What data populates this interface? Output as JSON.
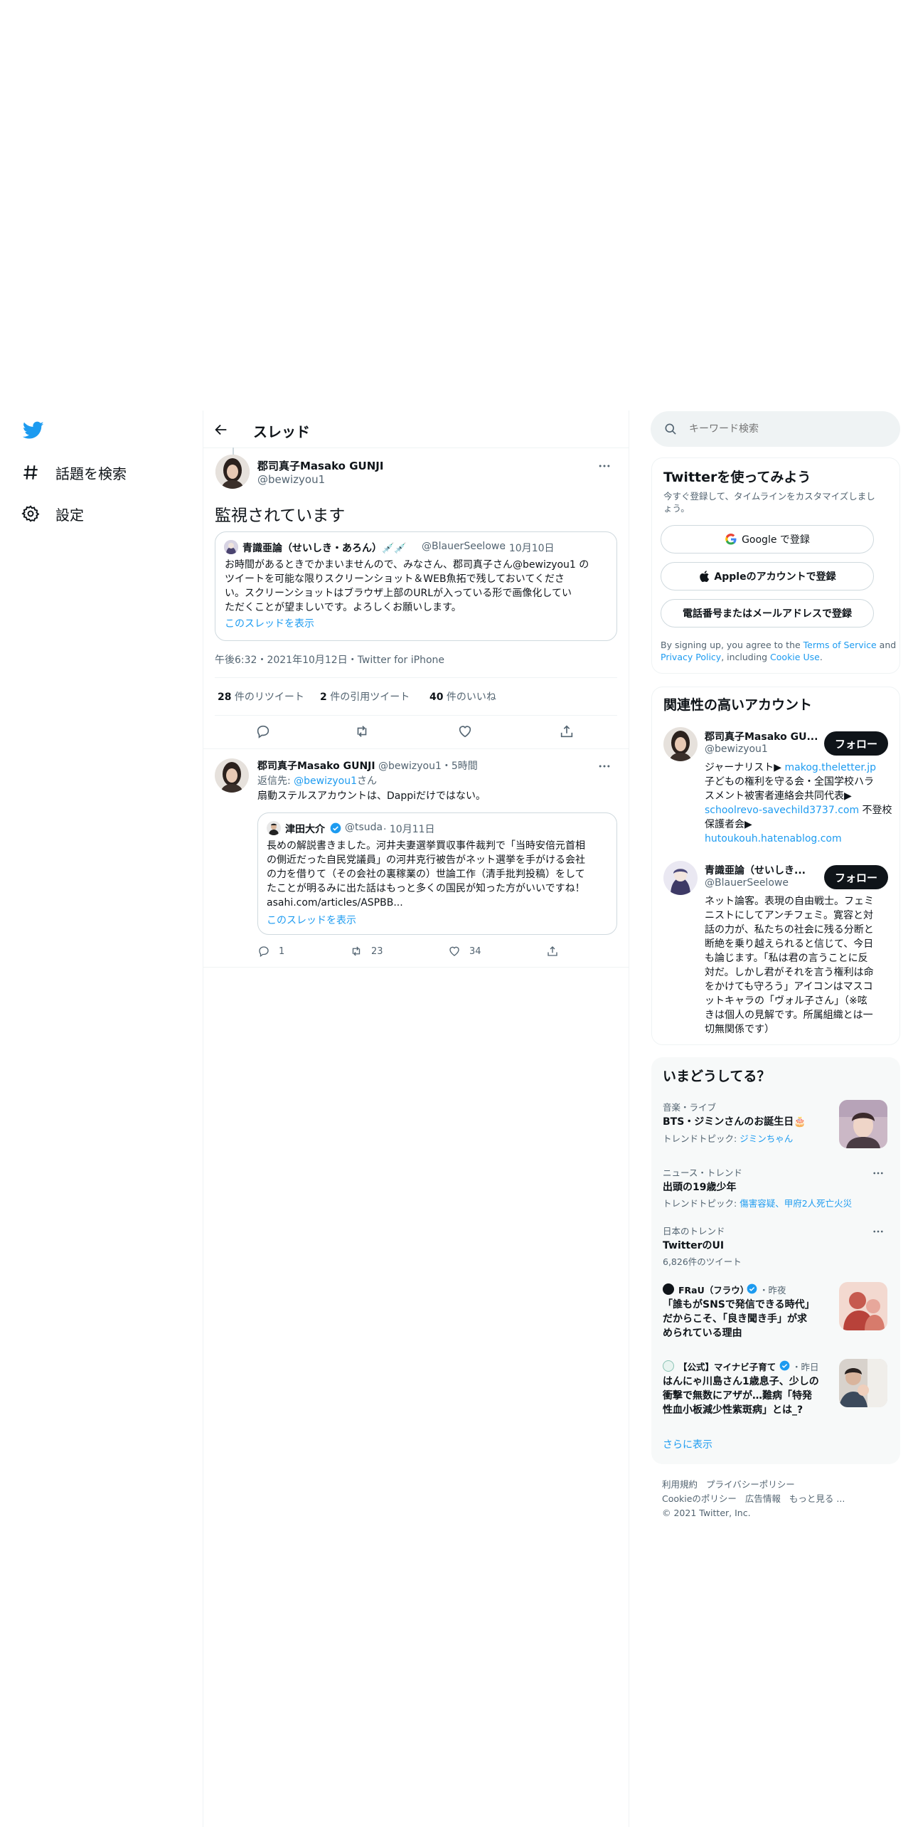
{
  "nav": {
    "explore_label": "話題を検索",
    "settings_label": "設定"
  },
  "header": {
    "title": "スレッド"
  },
  "main_tweet": {
    "name": "郡司真子Masako GUNJI",
    "handle": "@bewizyou1",
    "text": "監視されています",
    "quote": {
      "name": "青識亜論（せいしき・あろん）💉💉",
      "handle": "@BlauerSeelowe",
      "date": "· 10月10日",
      "lines": [
        "お時間があるときでかまいませんので、みなさん、郡司真子さん@bewizyou1 の",
        "ツイートを可能な限りスクリーンショット＆WEB魚拓で残しておいてくださ",
        "い。スクリーンショットはブラウザ上部のURLが入っている形で画像化してい",
        "ただくことが望ましいです。よろしくお願いします。"
      ],
      "show_thread": "このスレッドを表示"
    },
    "meta": "午後6:32・2021年10月12日・Twitter for iPhone",
    "retweets_count": "28",
    "retweets_label": " 件のリツイート",
    "quotes_count": "2",
    "quotes_label": " 件の引用ツイート",
    "likes_count": "40",
    "likes_label": " 件のいいね"
  },
  "reply": {
    "name": "郡司真子Masako GUNJI",
    "handle_time": "@bewizyou1・5時間",
    "reply_to_prefix": "返信先: ",
    "reply_to_handle": "@bewizyou1",
    "reply_to_suffix": "さん",
    "text": "扇動ステルスアカウントは、Dappiだけではない。",
    "quote": {
      "name": "津田大介",
      "handle": "@tsuda",
      "date": "· 10月11日",
      "lines": [
        "長めの解説書きました。河井夫妻選挙買収事件裁判で「当時安倍元首相",
        "の側近だった自民党議員」の河井克行被告がネット選挙を手がける会社",
        "の力を借りて（その会社の裏稼業の）世論工作（清手批判投稿）をして",
        "たことが明るみに出た話はもっと多くの国民が知った方がいいですね！",
        "asahi.com/articles/ASPBB..."
      ],
      "show_thread": "このスレッドを表示"
    },
    "reply_count": "1",
    "retweet_count": "23",
    "like_count": "34"
  },
  "search": {
    "placeholder": "キーワード検索"
  },
  "signup": {
    "title": "Twitterを使ってみよう",
    "subtitle_1": "今すぐ登録して、タイムラインをカスタマイズしまし",
    "subtitle_2": "ょう。",
    "google_label": "Google で登録",
    "apple_label": "Appleのアカウントで登録",
    "phone_label": "電話番号またはメールアドレスで登録",
    "legal_1": "By signing up, you agree to the ",
    "terms": "Terms of Service",
    "legal_2": " and",
    "privacy": "Privacy Policy",
    "legal_3": ", including ",
    "cookie": "Cookie Use",
    "legal_4": "."
  },
  "relevant": {
    "title": "関連性の高いアカウント",
    "follow_label": "フォロー",
    "acc1": {
      "name": "郡司真子Masako GU...",
      "handle": "@bewizyou1",
      "l1a": "ジャーナリスト▶ ",
      "l1b": "makog.theletter.jp",
      "l2": "子どもの権利を守る会・全国学校ハラ",
      "l3": "スメント被害者連絡会共同代表▶",
      "l4a": "schoolrevo-savechild3737.com",
      "l4b": " 不登校",
      "l5": "保護者会▶",
      "l6": "hutoukouh.hatenablog.com"
    },
    "acc2": {
      "name": "青識亜論（せいしき...",
      "handle": "@BlauerSeelowe",
      "lines": [
        "ネット論客。表現の自由戦士。フェミ",
        "ニストにしてアンチフェミ。寛容と対",
        "話の力が、私たちの社会に残る分断と",
        "断絶を乗り越えられると信じて、今日",
        "も論じます。「私は君の言うことに反",
        "対だ。しかし君がそれを言う権利は命",
        "をかけても守ろう」アイコンはマスコ",
        "ットキャラの「ヴォル子さん」（※呟",
        "きは個人の見解です。所属組織とは一",
        "切無関係です）"
      ]
    }
  },
  "trends": {
    "title": "いまどうしてる？",
    "t1": {
      "cat": "音楽・ライブ",
      "name": "BTS・ジミンさんのお誕生日🎂",
      "sub": "トレンドトピック: ",
      "link": "ジミンちゃん"
    },
    "t2": {
      "cat": "ニュース・トレンド",
      "name": "出頭の19歳少年",
      "sub": "トレンドトピック: ",
      "link": "傷害容疑、甲府2人死亡火災"
    },
    "t3": {
      "cat": "日本のトレンド",
      "name": "TwitterのUI",
      "sub": "6,826件のツイート"
    },
    "t4": {
      "source": "FRaU（フラウ）",
      "time": "・昨夜",
      "l1": "「誰もがSNSで発信できる時代」",
      "l2": "だからこそ、「良き聞き手」が求",
      "l3": "められている理由"
    },
    "t5": {
      "source": "【公式】マイナビ子育て",
      "time": "・昨日",
      "l1": "はんにゃ川島さん1歳息子、少しの",
      "l2": "衝撃で無数にアザが…難病「特発",
      "l3": "性血小板減少性紫斑病」とは_?"
    },
    "more": "さらに表示"
  },
  "footer": {
    "terms": "利用規約",
    "privacy": "プライバシーポリシー",
    "cookie": "Cookieのポリシー",
    "ads": "広告情報",
    "more": "もっと見る ...",
    "copyright": "© 2021 Twitter, Inc."
  },
  "colors": {
    "accent": "#1d9bf0",
    "text": "#0f1419",
    "muted": "#536471",
    "border": "#eff3f4"
  }
}
